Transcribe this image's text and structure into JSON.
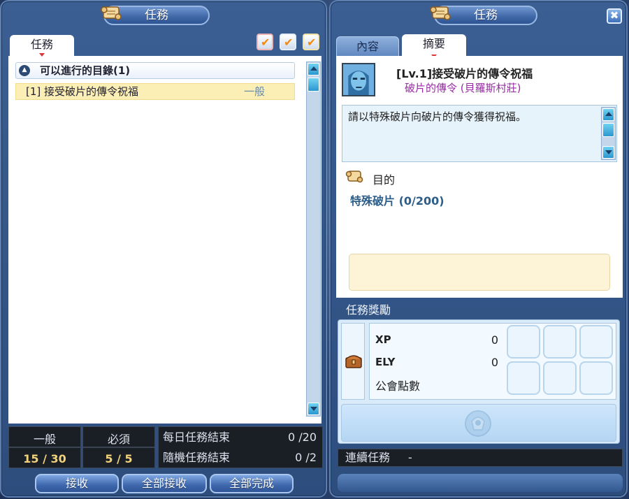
{
  "left_panel": {
    "title": "任務",
    "tab_label": "任務",
    "category": {
      "label": "可以進行的目錄(1)"
    },
    "quest": {
      "name": "[1] 接受破片的傳令祝福",
      "type": "一般"
    },
    "stats": {
      "normal": {
        "label": "一般",
        "value": "15 / 30"
      },
      "required": {
        "label": "必須",
        "value": "5 / 5"
      }
    },
    "status_rows": [
      {
        "label": "每日任務結束",
        "value": "0 /20"
      },
      {
        "label": "隨機任務結束",
        "value": "0 /2"
      }
    ],
    "buttons": {
      "accept": "接收",
      "accept_all": "全部接收",
      "complete_all": "全部完成"
    }
  },
  "right_panel": {
    "title": "任務",
    "close_glyph": "✖",
    "tabs": {
      "content": "內容",
      "summary": "摘要"
    },
    "quest_title": "[Lv.1]接受破片的傳令祝福",
    "npc": "破片的傳令 (貝羅斯村莊)",
    "description": "請以特殊破片向破片的傳令獲得祝福。",
    "goal_head": "目的",
    "goal_item": "特殊破片 (0/200)",
    "reward_head": "任務獎勵",
    "rewards": [
      {
        "label": "XP",
        "value": "0"
      },
      {
        "label": "ELY",
        "value": "0"
      },
      {
        "label": "公會點數",
        "value": ""
      }
    ],
    "chain": {
      "label": "連續任務",
      "value": "-"
    }
  },
  "icons": {
    "scroll": "scroll-icon",
    "checkbox": "checkbox-icon",
    "chest": "treasure-chest-icon",
    "emblem": "reward-emblem-icon"
  },
  "colors": {
    "panel": "#3b5f93",
    "quest_highlight": "#fbefb5",
    "npc_text": "#9a2aa6",
    "goal_text": "#2d5e8a",
    "stat_value": "#f2d37a"
  }
}
